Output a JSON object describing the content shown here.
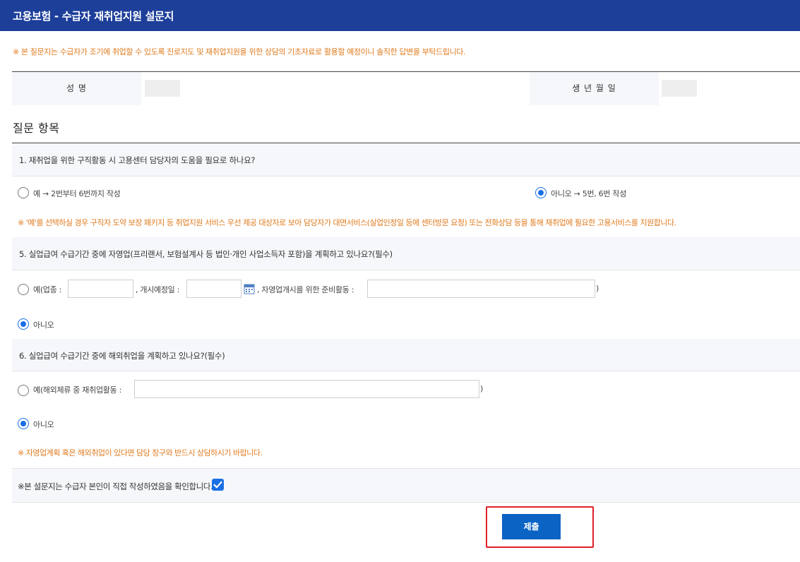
{
  "header": {
    "title": "고용보험 - 수급자 재취업지원 설문지"
  },
  "notice_top": "※ 본 질문지는 수급자가 조기에 취업할 수 있도록 진로지도 및 재취업지원을 위한 상담의 기초자료로 활용할 예정이니 솔직한 답변을 부탁드립니다.",
  "info": {
    "name_label": "성 명",
    "birth_label": "생 년 월 일"
  },
  "section_title": "질문 항목",
  "q1": {
    "text": "1. 재취업을 위한 구직활동 시 고용센터 담당자의 도움을 필요로 하나요?",
    "option_yes": "예 → 2번부터 6번까지 작성",
    "option_no": "아니오 → 5번, 6번 작성",
    "selected": "no",
    "note": "※ '예'를 선택하실 경우 구직자 도약 보장 패키지 등 취업지원 서비스 우선 제공 대상자로 보아 담당자가 대면서비스(실업인정일 등에 센터방문 요청) 또는 전화상담 등을 통해 재취업에 필요한 고용서비스를 지원합니다."
  },
  "q5": {
    "text": "5. 실업급여 수급기간 중에 자영업(프리랜서, 보험설계사 등 법인·개인 사업소득자 포함)을 계획하고 있나요?(필수)",
    "option_yes_prefix": "예(업종 :",
    "start_date_label": ", 개시예정일 :",
    "prep_label": ", 자영업개시를 위한 준비활동 :",
    "close_paren": ")",
    "option_no": "아니오",
    "selected": "no"
  },
  "q6": {
    "text": "6. 실업급여 수급기간 중에 해외취업을 계획하고 있나요?(필수)",
    "option_yes_prefix": "예(해외체류 중 재취업활동 :",
    "close_paren": ")",
    "option_no": "아니오",
    "selected": "no",
    "note": "※ 자영업계획 혹은 해외취업이 있다면 담당 창구와 반드시 상담하시기 바랍니다."
  },
  "confirm": {
    "text": "※본 설문지는 수급자 본인이 직접 작성하였음을 확인합니다.",
    "checked": true
  },
  "submit": {
    "label": "제출"
  },
  "colors": {
    "header_bg": "#1d3f9a",
    "notice": "#e07b1f",
    "accent": "#1a6ee6",
    "submit_bg": "#0b63c4",
    "highlight": "#e0202a"
  },
  "icons": {
    "calendar": "calendar-icon",
    "check": "check-icon"
  }
}
